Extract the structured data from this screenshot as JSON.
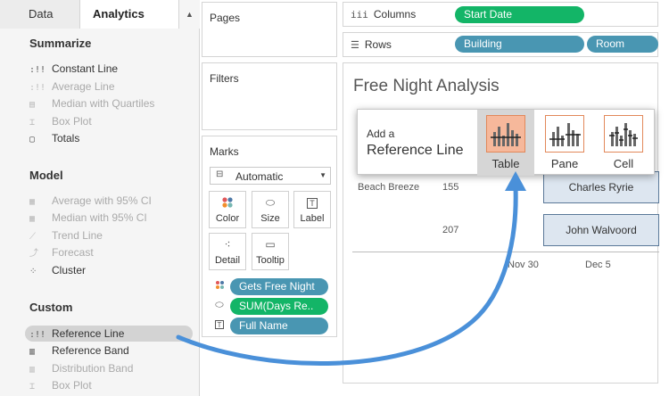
{
  "tabs": {
    "data": "Data",
    "analytics": "Analytics"
  },
  "summarize": {
    "title": "Summarize",
    "items": [
      {
        "icon": "constant-line-icon",
        "label": "Constant Line",
        "enabled": true
      },
      {
        "icon": "average-line-icon",
        "label": "Average Line",
        "enabled": false
      },
      {
        "icon": "median-quartiles-icon",
        "label": "Median with Quartiles",
        "enabled": false
      },
      {
        "icon": "box-plot-icon",
        "label": "Box Plot",
        "enabled": false
      },
      {
        "icon": "totals-icon",
        "label": "Totals",
        "enabled": true
      }
    ]
  },
  "model": {
    "title": "Model",
    "items": [
      {
        "icon": "average-ci-icon",
        "label": "Average with 95% CI",
        "enabled": false
      },
      {
        "icon": "median-ci-icon",
        "label": "Median with 95% CI",
        "enabled": false
      },
      {
        "icon": "trend-line-icon",
        "label": "Trend Line",
        "enabled": false
      },
      {
        "icon": "forecast-icon",
        "label": "Forecast",
        "enabled": false
      },
      {
        "icon": "cluster-icon",
        "label": "Cluster",
        "enabled": true
      }
    ]
  },
  "custom": {
    "title": "Custom",
    "items": [
      {
        "icon": "reference-line-icon",
        "label": "Reference Line",
        "enabled": true,
        "highlighted": true
      },
      {
        "icon": "reference-band-icon",
        "label": "Reference Band",
        "enabled": true
      },
      {
        "icon": "distribution-band-icon",
        "label": "Distribution Band",
        "enabled": false
      },
      {
        "icon": "box-plot-icon",
        "label": "Box Plot",
        "enabled": false
      }
    ]
  },
  "shelves": {
    "pages": "Pages",
    "filters": "Filters",
    "columns": "Columns",
    "rows": "Rows",
    "column_pills": [
      "Start Date"
    ],
    "row_pills": [
      "Building",
      "Room"
    ]
  },
  "marks": {
    "title": "Marks",
    "type": "Automatic",
    "buttons": [
      "Color",
      "Size",
      "Label",
      "Detail",
      "Tooltip"
    ],
    "fields": [
      "Gets Free Night",
      "SUM(Days Re..",
      "Full Name"
    ]
  },
  "view": {
    "title": "Free Night Analysis",
    "building": "Beach Breeze",
    "rooms": [
      "155",
      "207"
    ],
    "bars": [
      "Charles Ryrie",
      "John Walvoord"
    ],
    "axis_ticks": [
      "Nov 30",
      "Dec 5"
    ]
  },
  "popup": {
    "add": "Add a",
    "title": "Reference Line",
    "options": [
      "Table",
      "Pane",
      "Cell"
    ],
    "selected": "Table"
  },
  "colors": {
    "green_pill": "#13b567",
    "blue_pill": "#4996b2",
    "arrow": "#4a90d9",
    "selected_option": "#f6b89b"
  }
}
